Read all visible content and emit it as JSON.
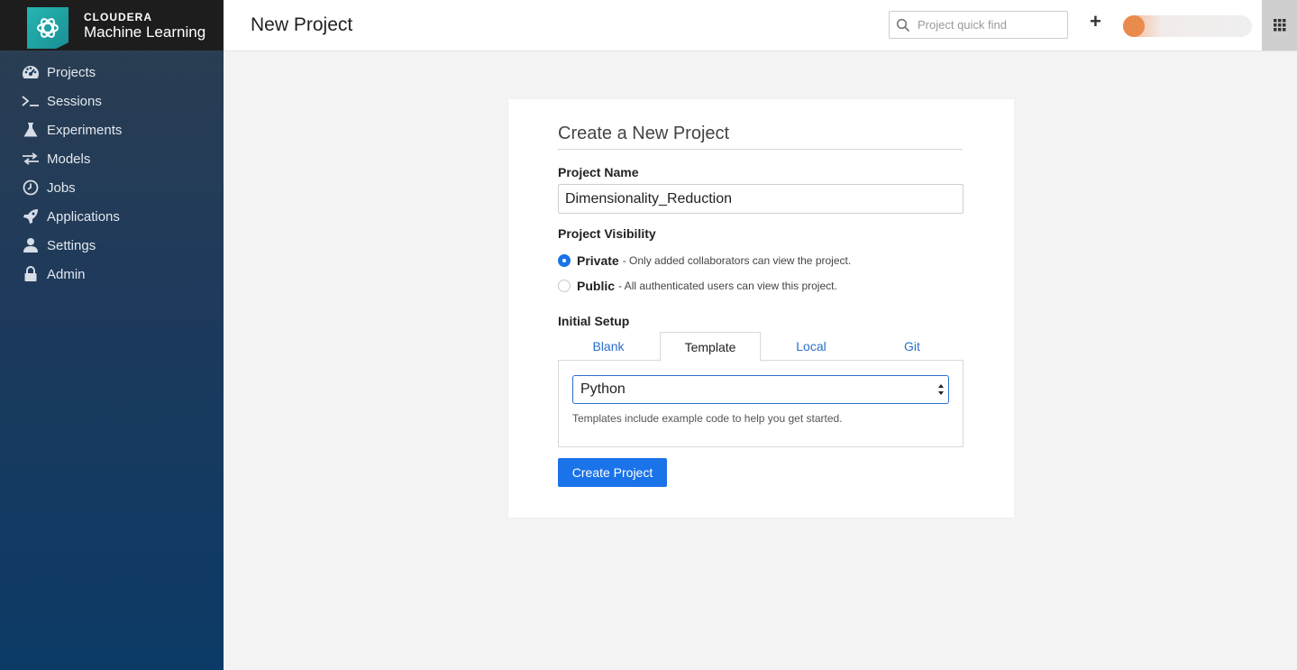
{
  "brand": {
    "line1": "CLOUDERA",
    "line2": "Machine Learning"
  },
  "sidebar": {
    "items": [
      {
        "label": "Projects",
        "icon": "dashboard-icon"
      },
      {
        "label": "Sessions",
        "icon": "terminal-icon"
      },
      {
        "label": "Experiments",
        "icon": "flask-icon"
      },
      {
        "label": "Models",
        "icon": "exchange-icon"
      },
      {
        "label": "Jobs",
        "icon": "clock-icon"
      },
      {
        "label": "Applications",
        "icon": "rocket-icon"
      },
      {
        "label": "Settings",
        "icon": "user-icon"
      },
      {
        "label": "Admin",
        "icon": "lock-icon"
      }
    ]
  },
  "header": {
    "title": "New Project",
    "search_placeholder": "Project quick find"
  },
  "form": {
    "title": "Create a New Project",
    "project_name_label": "Project Name",
    "project_name_value": "Dimensionality_Reduction",
    "visibility_label": "Project Visibility",
    "visibility_options": [
      {
        "title": "Private",
        "desc": "- Only added collaborators can view the project.",
        "checked": true
      },
      {
        "title": "Public",
        "desc": "- All authenticated users can view this project.",
        "checked": false
      }
    ],
    "setup_label": "Initial Setup",
    "tabs": [
      "Blank",
      "Template",
      "Local",
      "Git"
    ],
    "active_tab": "Template",
    "template_value": "Python",
    "template_help": "Templates include example code to help you get started.",
    "submit_label": "Create Project"
  },
  "colors": {
    "accent": "#1a73e8",
    "sidebar": "#1e3a5c",
    "brand_teal": "#25b5b0"
  }
}
